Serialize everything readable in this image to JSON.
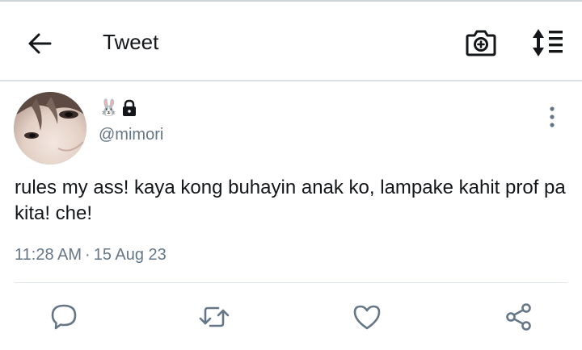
{
  "header": {
    "title": "Tweet",
    "back_icon": "arrow-left-icon",
    "camera_icon": "camera-plus-icon",
    "sort_icon": "sort-list-icon"
  },
  "tweet": {
    "display_name_emoji": "🐰",
    "protected_icon": "lock-icon",
    "handle": "@mimori",
    "text": "rules my ass! kaya kong buhayin anak ko, lampake kahit prof pa kita! che!",
    "time": "11:28 AM",
    "separator": "·",
    "date": "15 Aug 23"
  },
  "actions": {
    "reply_icon": "reply-icon",
    "retweet_icon": "retweet-icon",
    "like_icon": "heart-icon",
    "share_icon": "share-icon"
  },
  "colors": {
    "text_primary": "#14171a",
    "text_secondary": "#657786",
    "divider": "#e1e6ea"
  }
}
